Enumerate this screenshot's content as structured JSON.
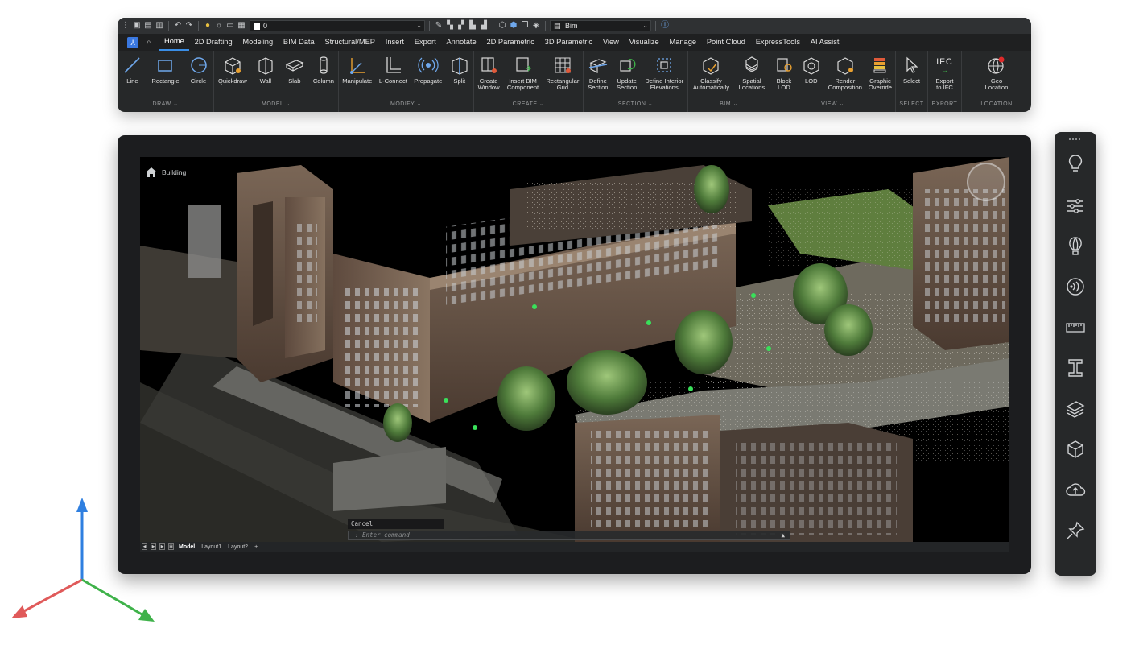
{
  "toolbar": {
    "layer_name": "0",
    "workspace": "Bim"
  },
  "tabs": [
    "Home",
    "2D Drafting",
    "Modeling",
    "BIM Data",
    "Structural/MEP",
    "Insert",
    "Export",
    "Annotate",
    "2D Parametric",
    "3D Parametric",
    "View",
    "Visualize",
    "Manage",
    "Point Cloud",
    "ExpressTools",
    "AI Assist"
  ],
  "active_tab": "Home",
  "groups": {
    "draw": {
      "label": "DRAW",
      "tools": [
        "Line",
        "Rectangle",
        "Circle"
      ]
    },
    "model": {
      "label": "MODEL",
      "tools": [
        "Quickdraw",
        "Wall",
        "Slab",
        "Column"
      ]
    },
    "modify": {
      "label": "MODIFY",
      "tools": [
        "Manipulate",
        "L-Connect",
        "Propagate",
        "Split"
      ]
    },
    "create": {
      "label": "CREATE",
      "tools": [
        "Create\nWindow",
        "Insert BIM\nComponent",
        "Rectangular\nGrid"
      ]
    },
    "section": {
      "label": "SECTION",
      "tools": [
        "Define\nSection",
        "Update\nSection",
        "Define Interior\nElevations"
      ]
    },
    "bim": {
      "label": "BIM",
      "tools": [
        "Classify\nAutomatically",
        "Spatial\nLocations"
      ]
    },
    "view": {
      "label": "VIEW",
      "tools": [
        "Block\nLOD",
        "LOD",
        "Render\nComposition",
        "Graphic\nOverride"
      ]
    },
    "select": {
      "label": "SELECT",
      "tools": [
        "Select"
      ]
    },
    "export": {
      "label": "EXPORT",
      "tools": [
        "Export\nto IFC"
      ]
    },
    "location": {
      "label": "LOCATION",
      "tools": [
        "Geo\nLocation"
      ]
    }
  },
  "ifc_text": "IFC",
  "viewport": {
    "breadcrumb": "Building",
    "command_history": "Cancel",
    "command_placeholder": ": Enter command",
    "layout_tabs": [
      "Model",
      "Layout1",
      "Layout2",
      "+"
    ],
    "active_layout": "Model"
  },
  "sidepanel_icons": [
    "lightbulb-icon",
    "sliders-icon",
    "hot-air-balloon-icon",
    "propagate-icon",
    "ruler-icon",
    "i-beam-icon",
    "layers-icon",
    "cube-icon",
    "cloud-upload-icon",
    "pin-icon"
  ],
  "colors": {
    "accent": "#3a8ee6",
    "ribbon_bg": "#262829",
    "axis_x": "#e05a5a",
    "axis_y": "#3fb24a",
    "axis_z": "#2f7fe0"
  }
}
